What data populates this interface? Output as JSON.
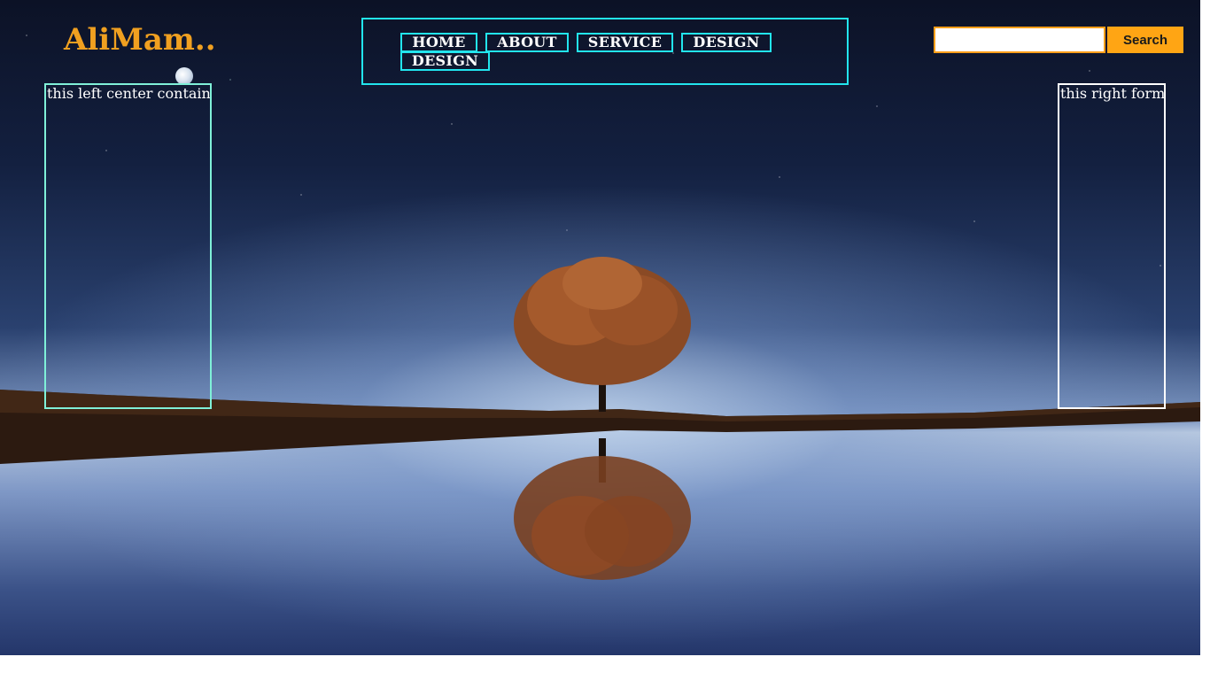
{
  "brand": {
    "logo_text": "AliMam.."
  },
  "nav": {
    "items": [
      {
        "label": "HOME"
      },
      {
        "label": "ABOUT"
      },
      {
        "label": "SERVICE"
      },
      {
        "label": "DESIGN"
      },
      {
        "label": "DESIGN"
      }
    ]
  },
  "search": {
    "value": "",
    "button_label": "Search"
  },
  "panels": {
    "left_text": "this left center contain",
    "right_text": "this right form"
  },
  "colors": {
    "logo": "#f0a020",
    "nav_border": "#22e5ee",
    "search_button": "#ffa514",
    "left_panel_border": "#7ff0d8",
    "right_panel_border": "#ffffff"
  },
  "icons": {
    "moon": "moon-icon"
  }
}
